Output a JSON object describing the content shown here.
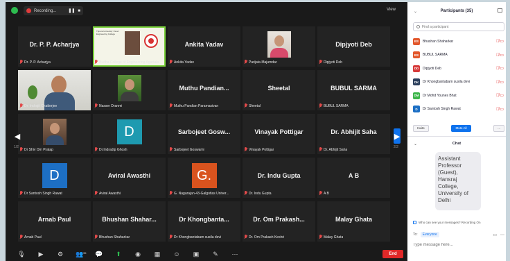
{
  "topbar": {
    "recording_label": "Recording...",
    "pause_glyph": "❚❚",
    "stop_glyph": "■",
    "view_label": "View"
  },
  "tiles": [
    {
      "name": "Dr. P. P. Acharjya",
      "label": "Dr. P. P. Acharjya",
      "kind": "name"
    },
    {
      "name": "",
      "label": "Budha College of Engineering Agartala",
      "kind": "slide",
      "slide_title": "Tripura University / Govt. Engineering College",
      "active": true
    },
    {
      "name": "Ankita Yadav",
      "label": "Ankita Yadav",
      "kind": "name"
    },
    {
      "name": "",
      "label": "Parijata Majumdar",
      "kind": "photo-f"
    },
    {
      "name": "Dipjyoti Deb",
      "label": "Dipjyoti Deb",
      "kind": "name"
    },
    {
      "name": "",
      "label": "Dr. Indrajit Chatterjee",
      "kind": "cam"
    },
    {
      "name": "",
      "label": "Nasser Dranmi",
      "kind": "photo-g"
    },
    {
      "name": "Muthu Pandian...",
      "label": "Muthu Pandian Paramasivan",
      "kind": "name"
    },
    {
      "name": "Sheetal",
      "label": "Sheetal",
      "kind": "name"
    },
    {
      "name": "BUBUL SARMA",
      "label": "BUBUL SARMA",
      "kind": "name"
    },
    {
      "name": "",
      "label": "Dr Shiv Om Pratap",
      "kind": "photo"
    },
    {
      "name": "D",
      "label": "Dr.Indradip Ghosh",
      "kind": "avatar",
      "color": "#1e9ab0"
    },
    {
      "name": "Sarbojeet Gosw...",
      "label": "Sarbojeet Goswami",
      "kind": "name"
    },
    {
      "name": "Vinayak Pottigar",
      "label": "Vinayak Pottigar",
      "kind": "name"
    },
    {
      "name": "Dr. Abhijit Saha",
      "label": "Dr. Abhijit Saha",
      "kind": "name"
    },
    {
      "name": "D",
      "label": "Dr Santosh Singh Rawat",
      "kind": "avatar",
      "color": "#1d6fc4"
    },
    {
      "name": "Aviral Awasthi",
      "label": "Aviral Awasthi",
      "kind": "name"
    },
    {
      "name": "G.",
      "label": "G. Nagarajan-43-Galgotias Univer...",
      "kind": "avatar",
      "color": "#d9531e"
    },
    {
      "name": "Dr. Indu Gupta",
      "label": "Dr. Indu Gupta",
      "kind": "name"
    },
    {
      "name": "A B",
      "label": "A B",
      "kind": "name"
    },
    {
      "name": "Arnab Paul",
      "label": "Arnab Paul",
      "kind": "name"
    },
    {
      "name": "Bhushan Shahar...",
      "label": "Bhushan Shaharkar",
      "kind": "name"
    },
    {
      "name": "Dr Khongbanta...",
      "label": "Dr Khongbantabam susila devi",
      "kind": "name"
    },
    {
      "name": "Dr. Om Prakash...",
      "label": "Dr. Om Prakash Keshri",
      "kind": "name"
    },
    {
      "name": "Malay Ghata",
      "label": "Malay Ghata",
      "kind": "name"
    }
  ],
  "pages": {
    "left": "1/2",
    "right": "2/2"
  },
  "toolbar": {
    "participants_count": "35",
    "end_label": "End"
  },
  "participants": {
    "title": "Participants (35)",
    "search_placeholder": "Find a participant",
    "list": [
      {
        "initials": "BS",
        "name": "Bhushan Shaharkar",
        "color": "#e2572b"
      },
      {
        "initials": "BS",
        "name": "BUBUL SARMA",
        "color": "#e2572b"
      },
      {
        "initials": "DD",
        "name": "Dipjyoti Deb",
        "color": "#d63a3a"
      },
      {
        "initials": "DK",
        "name": "Dr Khongbantabam susila devi",
        "color": "#2b3f5c"
      },
      {
        "initials": "DM",
        "name": "Dr Mohd Younes Bhat",
        "color": "#3cb54a"
      },
      {
        "initials": "D",
        "name": "Dr Santosh Singh Rawat",
        "color": "#1d6fc4"
      }
    ],
    "invite_label": "Invite",
    "mute_all_label": "Mute All",
    "more_label": "..."
  },
  "chat": {
    "title": "Chat",
    "message": "Assistant Professor (Guest), Hansraj College, University of Delhi",
    "notice": "Who can see your messages? Recording On",
    "to_label": "To:",
    "to_value": "Everyone",
    "input_placeholder": "Type message here..."
  }
}
